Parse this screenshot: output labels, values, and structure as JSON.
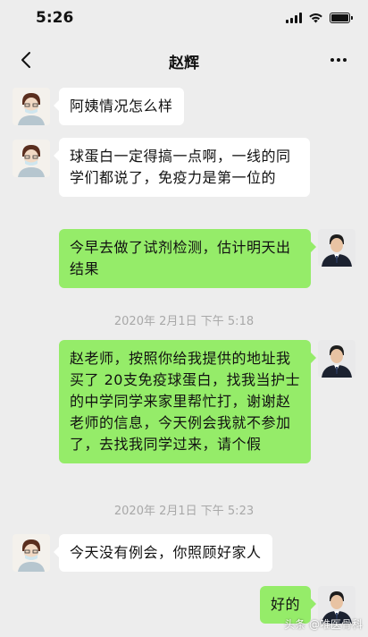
{
  "status": {
    "time": "5:26"
  },
  "header": {
    "title": "赵辉"
  },
  "messages": [
    {
      "side": "in",
      "text": "阿姨情况怎么样"
    },
    {
      "side": "in",
      "text": "球蛋白一定得搞一点啊，一线的同学们都说了，免疫力是第一位的"
    },
    {
      "side": "out",
      "text": "今早去做了试剂检测，估计明天出结果"
    },
    {
      "time": "2020年 2月1日 下午 5:18"
    },
    {
      "side": "out",
      "text": "赵老师，按照你给我提供的地址我买了 20支免疫球蛋白，找我当护士的中学同学来家里帮忙打，谢谢赵老师的信息，今天例会我就不参加了，去找我同学过来，请个假"
    },
    {
      "time": "2020年 2月1日 下午 5:23"
    },
    {
      "side": "in",
      "text": "今天没有例会，你照顾好家人"
    },
    {
      "side": "out",
      "text": "好的"
    }
  ],
  "watermark": "头条 @唯医骨科",
  "colors": {
    "background": "#ededed",
    "incoming": "#ffffff",
    "outgoing": "#95ec69"
  }
}
